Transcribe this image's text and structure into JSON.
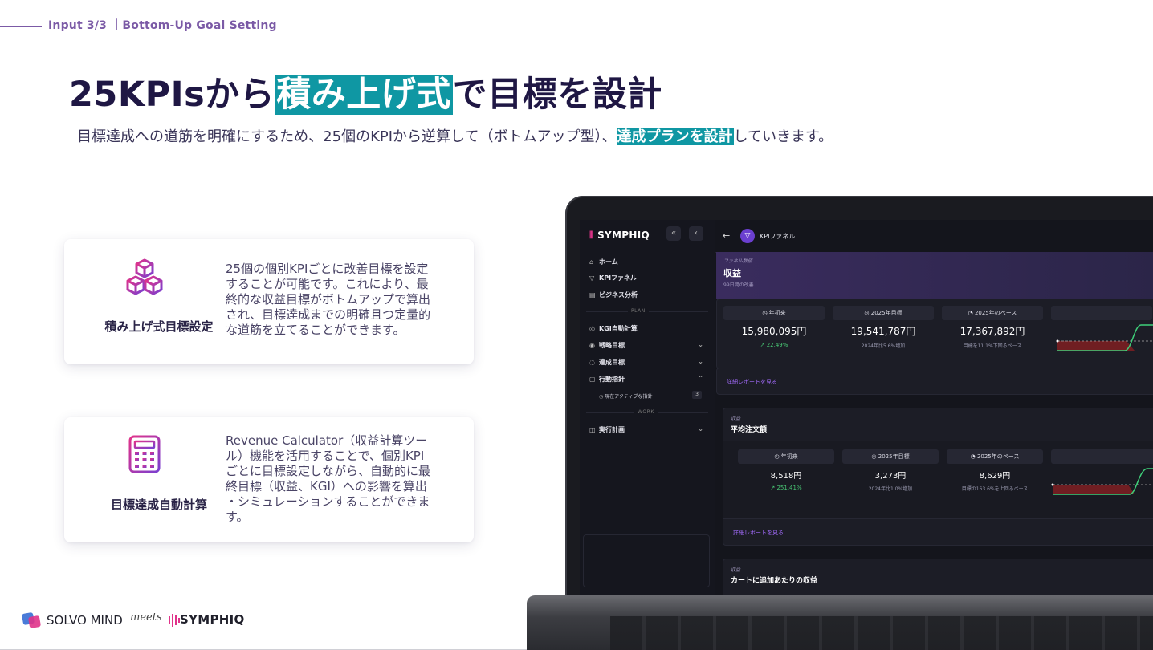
{
  "header": {
    "label": "Input 3/3 ｜Bottom-Up Goal Setting"
  },
  "title": {
    "prefix": "25KPIsから",
    "highlight": "積み上げ式",
    "suffix": "で目標を設計"
  },
  "subtitle": {
    "prefix": "目標達成への道筋を明確にするため、25個のKPIから逆算して（ボトムアップ型）、",
    "highlight": "達成プランを設計",
    "suffix": "していきます。"
  },
  "cards": [
    {
      "label": "積み上げ式目標設定",
      "icon": "cubes-icon",
      "desc": [
        "25個の個別KPIごとに改善目標を設定",
        "することが可能です。これにより、最",
        "終的な収益目標がボトムアップで算出",
        "され、目標達成までの明確且つ定量的",
        "な道筋を立てることができます。"
      ]
    },
    {
      "label": "目標達成自動計算",
      "icon": "calculator-icon",
      "desc": [
        "Revenue Calculator（収益計算ツー",
        "ル）機能を活用することで、個別KPI",
        "ごとに目標設定しながら、自動的に最",
        "終目標（収益、KGI）への影響を算出",
        "・シミュレーションすることができま",
        "す。"
      ]
    }
  ],
  "footer": {
    "solvo": "SOLVO MIND",
    "meets": "meets",
    "symphiq": "SYMPHIQ"
  },
  "colors": {
    "accent": "#0f97a3",
    "brand": "#7b5aa6",
    "title": "#1f1744"
  },
  "app": {
    "logo": "SYMPHIQ",
    "sidebar": {
      "collapse": "«",
      "back": "‹",
      "items": [
        {
          "label": "ホーム",
          "icon": "home-icon"
        },
        {
          "label": "KPIファネル",
          "icon": "funnel-icon"
        },
        {
          "label": "ビジネス分析",
          "icon": "doc-icon"
        }
      ],
      "section_plan": "PLAN",
      "plan_items": [
        {
          "label": "KGI自動計算"
        },
        {
          "label": "戦略目標"
        },
        {
          "label": "達成目標"
        },
        {
          "label": "行動指針"
        }
      ],
      "sub_item": {
        "label": "現在アクティブな指針",
        "count": "3"
      },
      "section_work": "WORK",
      "work_items": [
        {
          "label": "実行計画"
        }
      ]
    },
    "topbar": {
      "label": "KPIファネル"
    },
    "panel1": {
      "caption": "ファネル数値",
      "title": "収益",
      "sub": "99日間の改善",
      "stats": [
        {
          "label": "年初来",
          "value": "15,980,095円",
          "note": "↗ 22.49%"
        },
        {
          "label": "2025年目標",
          "value": "19,541,787円",
          "note": "2024年比5.6%増加"
        },
        {
          "label": "2025年のペース",
          "value": "17,367,892円",
          "note": "目標を11.1%下回るペース"
        }
      ],
      "link": "詳細レポートを見る"
    },
    "panel2": {
      "caption": "収益",
      "title": "平均注文額",
      "stats": [
        {
          "label": "年初来",
          "value": "8,518円",
          "note": "↗ 251.41%"
        },
        {
          "label": "2025年目標",
          "value": "3,273円",
          "note": "2024年比1.0%増加"
        },
        {
          "label": "2025年のペース",
          "value": "8,629円",
          "note": "目標の163.6%を上回るペース"
        }
      ],
      "link": "詳細レポートを見る"
    },
    "panel3": {
      "caption": "収益",
      "title": "カートに追加あたりの収益"
    }
  }
}
